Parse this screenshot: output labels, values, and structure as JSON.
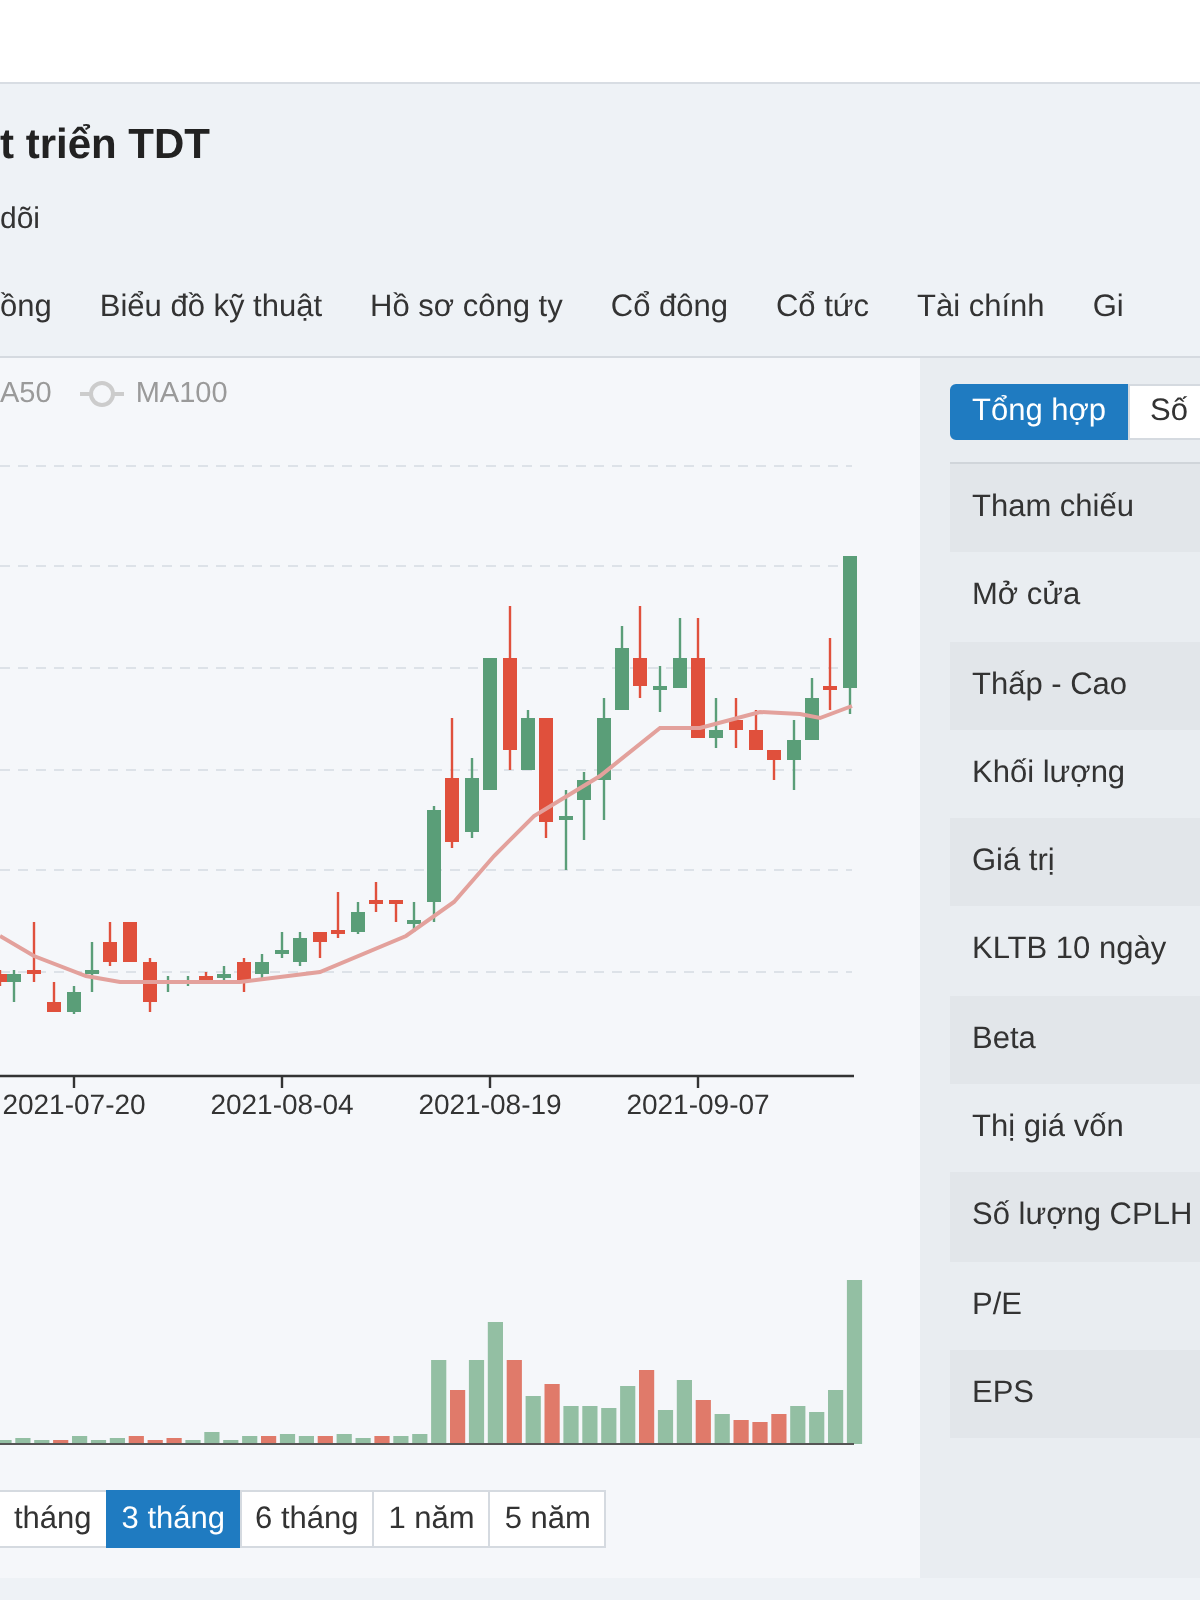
{
  "header": {
    "title": "t triển TDT",
    "follow": "dõi"
  },
  "tabs": [
    "ồng",
    "Biểu đồ kỹ thuật",
    "Hồ sơ công ty",
    "Cổ đông",
    "Cổ tức",
    "Tài chính",
    "Gi"
  ],
  "price_chart": {
    "legend": [
      {
        "label": "A50",
        "kind": "plain"
      },
      {
        "label": "MA100",
        "kind": "marker"
      }
    ],
    "x_labels": [
      "2021-07-20",
      "2021-08-04",
      "2021-08-19",
      "2021-09-07"
    ]
  },
  "ranges": [
    {
      "label": "tháng",
      "selected": false
    },
    {
      "label": "3 tháng",
      "selected": true
    },
    {
      "label": "6 tháng",
      "selected": false
    },
    {
      "label": "1 năm",
      "selected": false
    },
    {
      "label": "5 năm",
      "selected": false
    }
  ],
  "summary": {
    "toggle": [
      {
        "label": "Tổng hợp",
        "selected": true
      },
      {
        "label": "Số",
        "selected": false
      }
    ],
    "rows": [
      "Tham chiếu",
      "Mở cửa",
      "Thấp - Cao",
      "Khối lượng",
      "Giá trị",
      "KLTB 10 ngày",
      "Beta",
      "Thị giá vốn",
      "Số lượng CPLH",
      "P/E",
      "EPS"
    ]
  }
}
